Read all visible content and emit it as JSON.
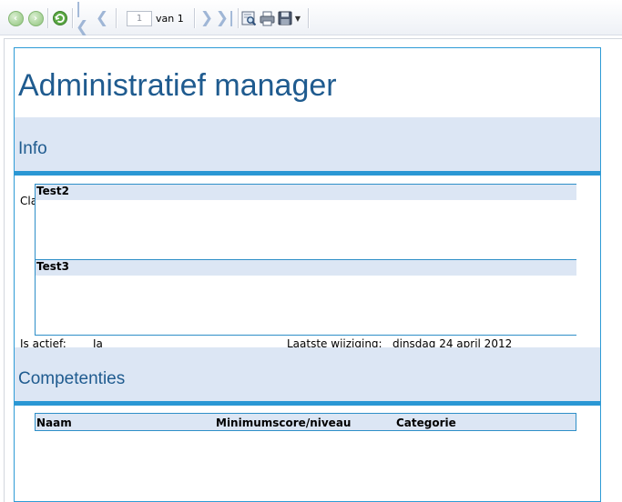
{
  "toolbar": {
    "page_current": "1",
    "page_of": "van 1",
    "icons": [
      "back-icon",
      "forward-icon",
      "refresh-icon",
      "first-page-icon",
      "previous-page-icon",
      "next-page-icon",
      "last-page-icon",
      "find-icon",
      "print-icon",
      "save-icon",
      "dropdown-arrow-icon"
    ]
  },
  "report": {
    "title": "Administratief manager",
    "info_section": "Info",
    "cla_label": "Cla",
    "subreport_items": [
      "Test2",
      "Test3"
    ],
    "is_actief_label": "Is actief:",
    "is_actief_value": "Ja",
    "laatste_wijziging_label": "Laatste wijziging:",
    "laatste_wijziging_value": "dinsdag 24 april 2012",
    "competenties_section": "Competenties",
    "columns": [
      "Naam",
      "Minimumscore/niveau",
      "Categorie"
    ]
  },
  "colors": {
    "accent": "#2a97d4",
    "section_bg": "#dce6f4",
    "title": "#1f5b8f"
  }
}
